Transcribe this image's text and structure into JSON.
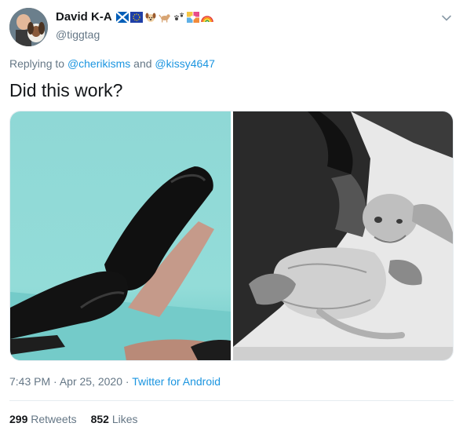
{
  "author": {
    "display_name": "David K-A",
    "handle": "@tiggtag",
    "name_emojis": [
      "scotland-flag-icon",
      "eu-flag-icon",
      "dog-face-icon",
      "dog-icon",
      "paw-prints-icon",
      "love-hearts-icon",
      "rainbow-icon"
    ]
  },
  "reply": {
    "prefix": "Replying to",
    "mention1": "@cherikisms",
    "joiner": "and",
    "mention2": "@kissy4647"
  },
  "tweet": {
    "text": "Did this work?"
  },
  "meta": {
    "time": "7:43 PM",
    "sep1": "·",
    "date": "Apr 25, 2020",
    "sep2": "·",
    "source": "Twitter for Android"
  },
  "stats": {
    "retweets_count": "299",
    "retweets_label": "Retweets",
    "likes_count": "852",
    "likes_label": "Likes"
  },
  "colors": {
    "link": "#1b95e0",
    "secondary_text": "#657786",
    "primary_text": "#14171a",
    "border": "#e6ecf0"
  }
}
